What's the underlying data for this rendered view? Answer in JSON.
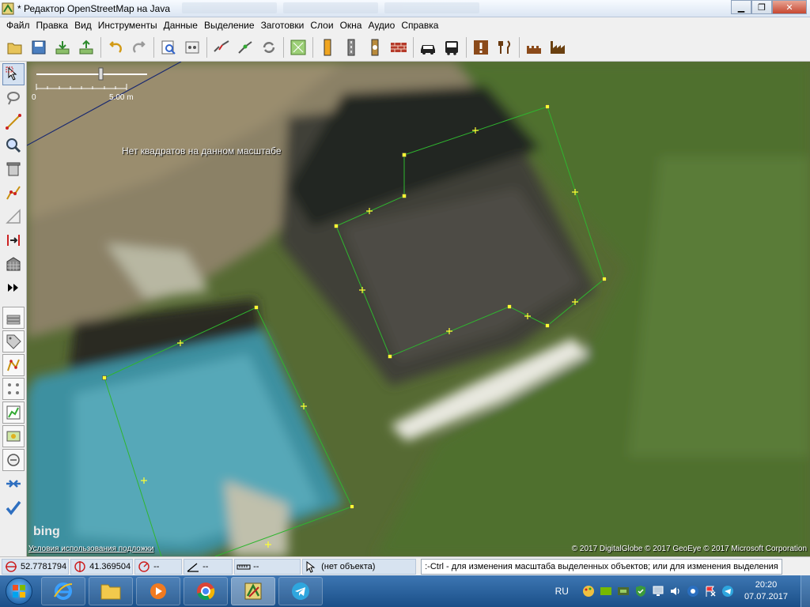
{
  "window": {
    "title": "* Редактор OpenStreetMap на Java",
    "min_label": "▁",
    "max_label": "❐",
    "close_label": "✕"
  },
  "menu": [
    "Файл",
    "Правка",
    "Вид",
    "Инструменты",
    "Данные",
    "Выделение",
    "Заготовки",
    "Слои",
    "Окна",
    "Аудио",
    "Справка"
  ],
  "map": {
    "scale_start": "0",
    "scale_end": "5.00 m",
    "no_tiles_message": "Нет квадратов на данном масштабе",
    "bing_logo": "bing",
    "terms_link": "Условия использования подложки",
    "copyright": "© 2017 DigitalGlobe © 2017 GeoEye © 2017 Microsoft Corporation"
  },
  "status": {
    "lat": "52.7781794",
    "lon": "41.369504",
    "heading": "--",
    "angle": "--",
    "distance": "--",
    "object": "(нет объекта)",
    "hint": ":-Ctrl - для изменения масштаба выделенных объектов; или для изменения выделения"
  },
  "taskbar": {
    "language": "RU",
    "time": "20:20",
    "date": "07.07.2017"
  },
  "colors": {
    "way_line": "#2fb52f",
    "node": "#ffff33",
    "taskbar": "#1f5a97"
  }
}
